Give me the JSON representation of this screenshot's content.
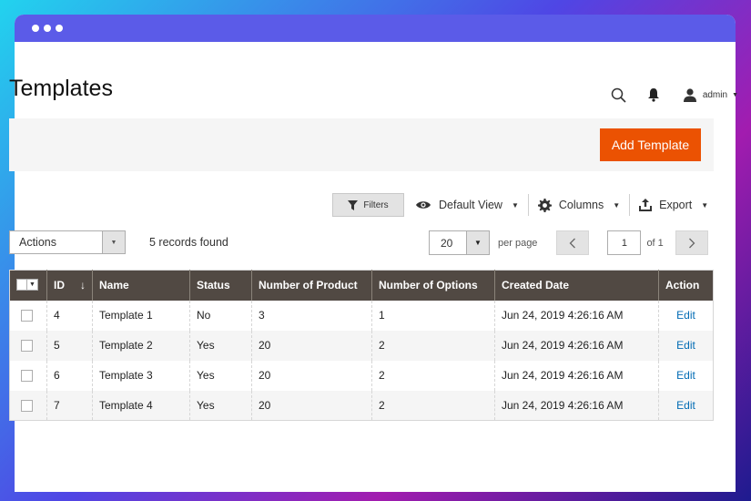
{
  "page": {
    "title": "Templates"
  },
  "header": {
    "user_name": "admin"
  },
  "action_bar": {
    "add_button": "Add Template"
  },
  "toolbar": {
    "filters": "Filters",
    "view": "Default View",
    "columns": "Columns",
    "export": "Export"
  },
  "grid_controls": {
    "actions_label": "Actions",
    "records_found": "5 records found",
    "per_page_value": "20",
    "per_page_label": "per page",
    "current_page": "1",
    "page_of": "of 1"
  },
  "table": {
    "columns": [
      "ID",
      "Name",
      "Status",
      "Number of Product",
      "Number of Options",
      "Created Date",
      "Action"
    ],
    "rows": [
      {
        "id": "4",
        "name": "Template 1",
        "status": "No",
        "products": "3",
        "options": "1",
        "created": "Jun 24, 2019 4:26:16 AM",
        "action": "Edit"
      },
      {
        "id": "5",
        "name": "Template 2",
        "status": "Yes",
        "products": "20",
        "options": "2",
        "created": "Jun 24, 2019 4:26:16 AM",
        "action": "Edit"
      },
      {
        "id": "6",
        "name": "Template 3",
        "status": "Yes",
        "products": "20",
        "options": "2",
        "created": "Jun 24, 2019 4:26:16 AM",
        "action": "Edit"
      },
      {
        "id": "7",
        "name": "Template 4",
        "status": "Yes",
        "products": "20",
        "options": "2",
        "created": "Jun 24, 2019 4:26:16 AM",
        "action": "Edit"
      }
    ]
  },
  "colors": {
    "titlebar": "#5b5be8",
    "accent_button": "#eb5202",
    "table_header": "#514943",
    "link": "#006bb4"
  },
  "icons": [
    "search-icon",
    "bell-icon",
    "user-icon",
    "filter-icon",
    "eye-icon",
    "gear-icon",
    "export-icon",
    "chevron-left-icon",
    "chevron-right-icon",
    "sort-down-icon"
  ]
}
